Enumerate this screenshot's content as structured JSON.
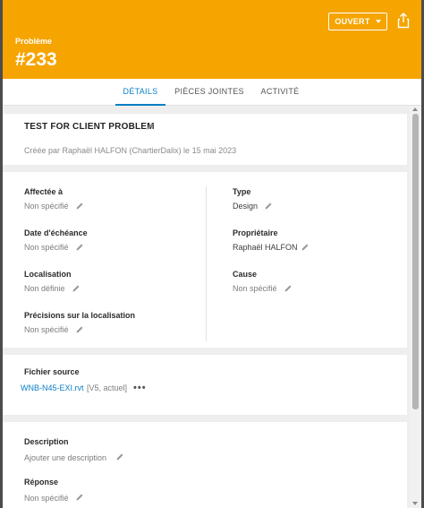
{
  "header": {
    "status_label": "OUVERT",
    "issue_type": "Problème",
    "issue_number": "#233",
    "color": "#f5a400"
  },
  "tabs": [
    {
      "label": "DÉTAILS",
      "active": true
    },
    {
      "label": "PIÈCES JOINTES",
      "active": false
    },
    {
      "label": "ACTIVITÉ",
      "active": false
    }
  ],
  "issue": {
    "title": "TEST FOR CLIENT PROBLEM",
    "created_by": "Créée par Raphaël HALFON (ChartierDalix) le 15 mai 2023"
  },
  "fields": {
    "assigned_to": {
      "label": "Affectée à",
      "value": "Non spécifié"
    },
    "due_date": {
      "label": "Date d'échéance",
      "value": "Non spécifié"
    },
    "location": {
      "label": "Localisation",
      "value": "Non définie"
    },
    "location_details": {
      "label": "Précisions sur la localisation",
      "value": "Non spécifié"
    },
    "type": {
      "label": "Type",
      "value": "Design"
    },
    "owner": {
      "label": "Propriétaire",
      "value": "Raphaël HALFON"
    },
    "cause": {
      "label": "Cause",
      "value": "Non spécifié"
    }
  },
  "source_file": {
    "label": "Fichier source",
    "name": "WNB-N45-EXI.rvt",
    "version": "[V5, actuel]",
    "more": "•••"
  },
  "description": {
    "label": "Description",
    "placeholder": "Ajouter une description"
  },
  "response": {
    "label": "Réponse",
    "value": "Non spécifié"
  },
  "accent_color": "#0b7fc7"
}
